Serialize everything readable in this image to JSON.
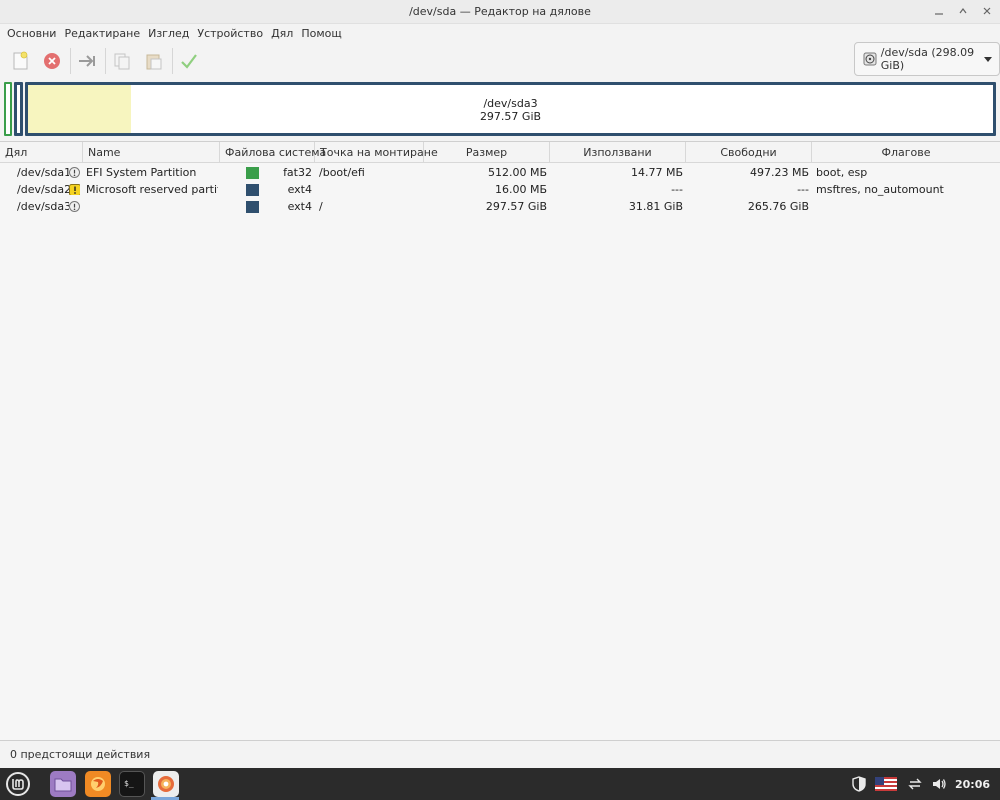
{
  "window": {
    "title": "/dev/sda — Редактор на дялове"
  },
  "menu": [
    "Основни",
    "Редактиране",
    "Изглед",
    "Устройство",
    "Дял",
    "Помощ"
  ],
  "device_selector": {
    "label": "/dev/sda (298.09 GiB)"
  },
  "disk_graphic": {
    "selected_name": "/dev/sda3",
    "selected_size": "297.57 GiB",
    "colors": {
      "fat32": "#3a9e4a",
      "ext4": "#2f4f6e",
      "used": "#f7f5bf"
    }
  },
  "table": {
    "columns": [
      "Дял",
      "Name",
      "Файлова система",
      "Точка на монтиране",
      "Размер",
      "Използвани",
      "Свободни",
      "Флагове"
    ],
    "rows": [
      {
        "partition": "/dev/sda1",
        "status": "info",
        "name": "EFI System Partition",
        "fs": "fat32",
        "fs_color": "#3a9e4a",
        "mount": "/boot/efi",
        "size": "512.00 МБ",
        "used": "14.77 МБ",
        "free": "497.23 МБ",
        "flags": "boot, esp"
      },
      {
        "partition": "/dev/sda2",
        "status": "warning",
        "name": "Microsoft reserved partition",
        "fs": "ext4",
        "fs_color": "#2f4f6e",
        "mount": "",
        "size": "16.00 МБ",
        "used": "---",
        "free": "---",
        "flags": "msftres, no_automount"
      },
      {
        "partition": "/dev/sda3",
        "status": "info",
        "name": "",
        "fs": "ext4",
        "fs_color": "#2f4f6e",
        "mount": "/",
        "size": "297.57 GiB",
        "used": "31.81 GiB",
        "free": "265.76 GiB",
        "flags": ""
      }
    ]
  },
  "statusbar": {
    "text": "0 предстоящи действия"
  },
  "taskbar": {
    "clock": "20:06"
  }
}
